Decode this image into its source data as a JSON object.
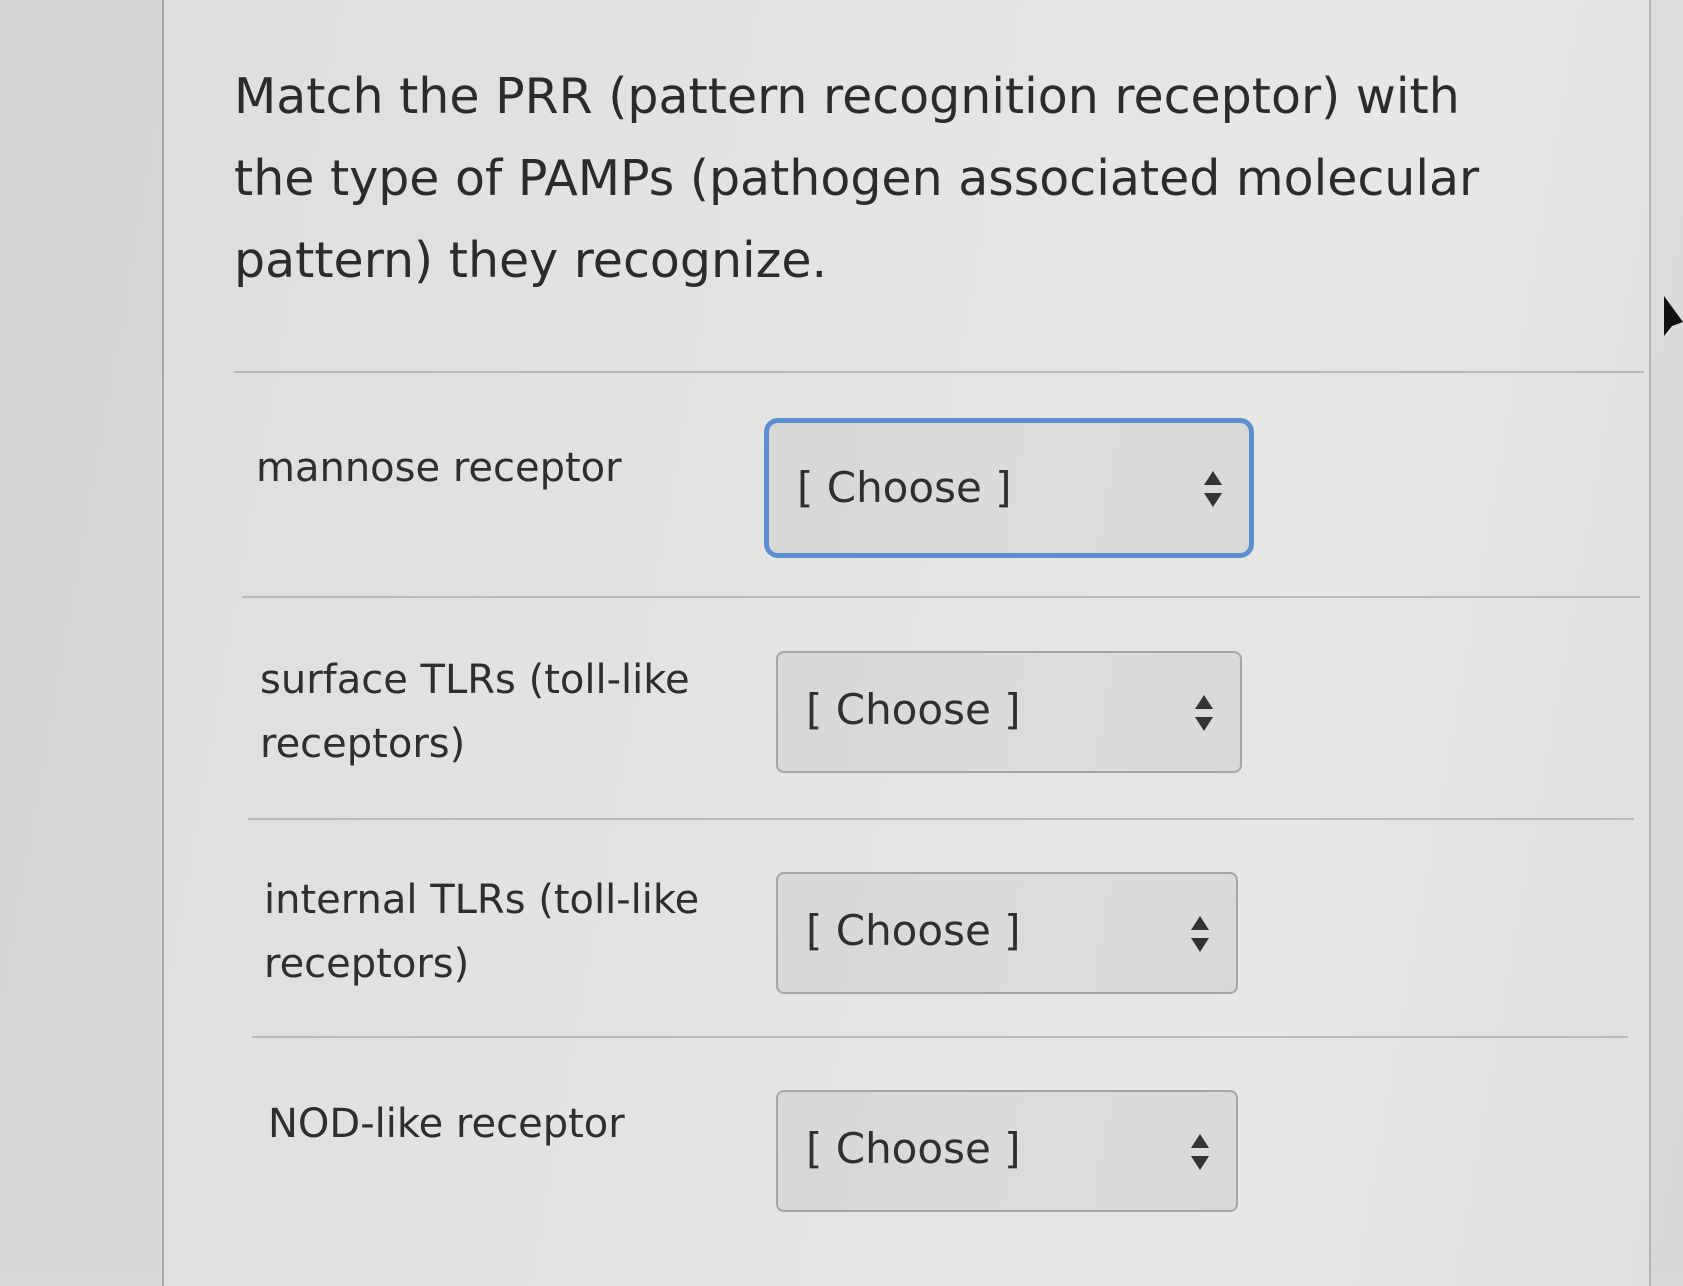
{
  "question": {
    "text": "Match the PRR (pattern recognition receptor) with the type of PAMPs (pathogen associated molecular pattern) they recognize."
  },
  "rows": [
    {
      "label": "mannose receptor",
      "select_value": "[ Choose ]",
      "focused": true
    },
    {
      "label": "surface TLRs (toll-like receptors)",
      "select_value": "[ Choose ]",
      "focused": false
    },
    {
      "label": "internal TLRs (toll-like receptors)",
      "select_value": "[ Choose ]",
      "focused": false
    },
    {
      "label": "NOD-like receptor",
      "select_value": "[ Choose ]",
      "focused": false
    }
  ],
  "icons": {
    "select_caret": "up-down-caret-icon",
    "mouse_pointer": "mouse-pointer-icon"
  },
  "colors": {
    "focus_ring": "#5b8fd0",
    "text": "#2b2b2b"
  }
}
